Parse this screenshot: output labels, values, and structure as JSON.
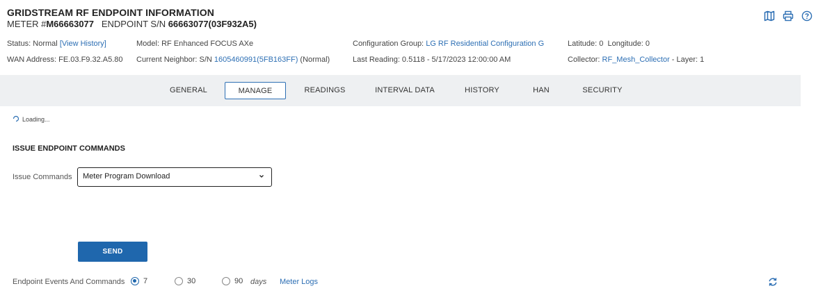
{
  "header": {
    "title": "GRIDSTREAM RF ENDPOINT INFORMATION",
    "meter_prefix": "METER #",
    "meter_number": "M66663077",
    "endpoint_prefix": "ENDPOINT S/N",
    "endpoint_sn": "66663077(03F932A5)"
  },
  "toolbar": {
    "icons": [
      "map-icon",
      "print-icon",
      "help-icon"
    ]
  },
  "info": {
    "status_label": "Status: Normal",
    "view_history": "[View History]",
    "wan_address": "WAN Address: FE.03.F9.32.A5.80",
    "model": "Model: RF Enhanced FOCUS AXe",
    "neighbor_label": "Current Neighbor: S/N",
    "neighbor_link": "1605460991(5FB163FF)",
    "neighbor_status": "(Normal)",
    "config_group_label": "Configuration Group:",
    "config_group_link": "LG RF Residential Configuration G",
    "last_reading": "Last Reading: 0.5118 - 5/17/2023 12:00:00 AM",
    "lat_long": "Latitude: 0  Longitude: 0",
    "collector_label": "Collector:",
    "collector_link": "RF_Mesh_Collector",
    "collector_layer": "- Layer: 1"
  },
  "tabs": [
    {
      "label": "GENERAL",
      "active": false
    },
    {
      "label": "MANAGE",
      "active": true
    },
    {
      "label": "READINGS",
      "active": false
    },
    {
      "label": "INTERVAL DATA",
      "active": false
    },
    {
      "label": "HISTORY",
      "active": false
    },
    {
      "label": "HAN",
      "active": false
    },
    {
      "label": "SECURITY",
      "active": false
    }
  ],
  "main": {
    "loading": "Loading...",
    "section_title": "ISSUE ENDPOINT COMMANDS",
    "issue_commands_label": "Issue Commands",
    "selected_command": "Meter Program Download",
    "send_label": "SEND"
  },
  "events": {
    "label": "Endpoint Events And Commands",
    "options": [
      "7",
      "30",
      "90"
    ],
    "selected": "7",
    "days_label": "days",
    "meter_logs": "Meter Logs"
  },
  "colors": {
    "accent": "#2d6fb4",
    "button": "#1f67ad",
    "tabbar": "#eef0f2"
  }
}
